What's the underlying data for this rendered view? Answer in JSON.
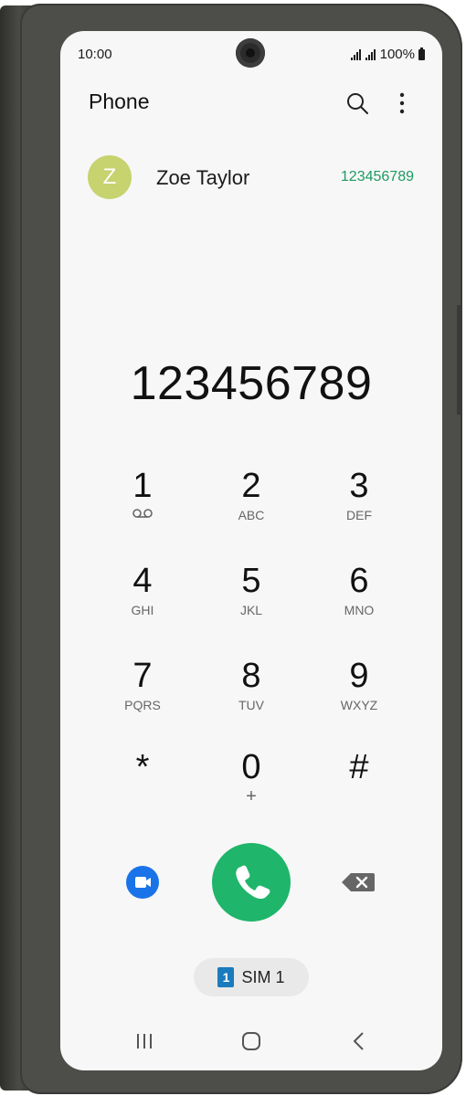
{
  "status_bar": {
    "time": "10:00",
    "battery": "100%"
  },
  "header": {
    "title": "Phone"
  },
  "contact_suggestion": {
    "initial": "Z",
    "name": "Zoe Taylor",
    "number": "123456789"
  },
  "dialer": {
    "entered_number": "123456789"
  },
  "keypad": [
    {
      "digit": "1",
      "letters": ""
    },
    {
      "digit": "2",
      "letters": "ABC"
    },
    {
      "digit": "3",
      "letters": "DEF"
    },
    {
      "digit": "4",
      "letters": "GHI"
    },
    {
      "digit": "5",
      "letters": "JKL"
    },
    {
      "digit": "6",
      "letters": "MNO"
    },
    {
      "digit": "7",
      "letters": "PQRS"
    },
    {
      "digit": "8",
      "letters": "TUV"
    },
    {
      "digit": "9",
      "letters": "WXYZ"
    },
    {
      "digit": "*",
      "letters": ""
    },
    {
      "digit": "0",
      "letters": "+"
    },
    {
      "digit": "#",
      "letters": ""
    }
  ],
  "sim": {
    "badge": "1",
    "label": "SIM 1"
  },
  "colors": {
    "call": "#1fb56b",
    "video": "#1a73e8",
    "contact_number": "#1f9a63",
    "avatar": "#c6d36e"
  },
  "icons": [
    "search-icon",
    "more-options-icon",
    "voicemail-icon",
    "video-call-icon",
    "phone-icon",
    "backspace-icon",
    "recents-nav-icon",
    "home-nav-icon",
    "back-nav-icon"
  ]
}
